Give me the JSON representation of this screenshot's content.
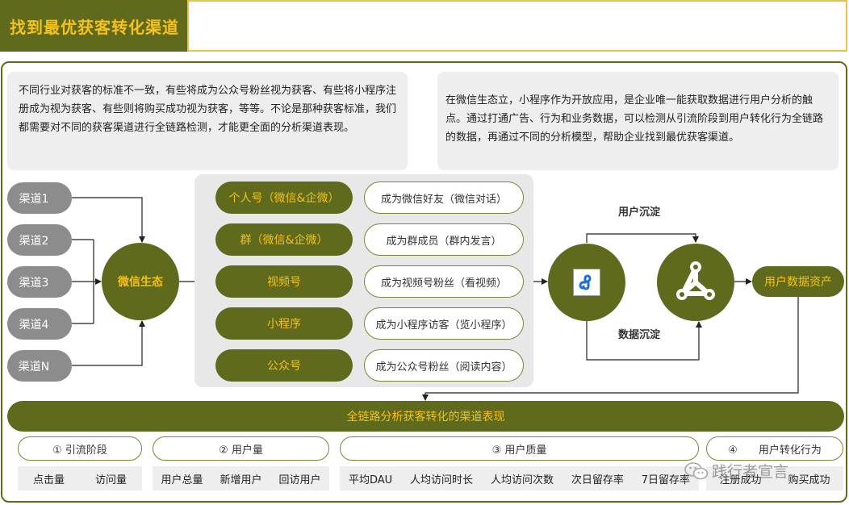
{
  "title": "找到最优获客转化渠道",
  "intro_left": "不同行业对获客的标准不一致，有些将成为公众号粉丝视为获客、有些将小程序注册成为视为获客、有些则将购买成功视为获客，等等。不论是那种获客标准，我们都需要对不同的获客渠道进行全链路检测，才能更全面的分析渠道表现。",
  "intro_right": "在微信生态立，小程序作为开放应用，是企业唯一能获取数据进行用户分析的触点。通过打通广告、行为和业务数据，可以检测从引流阶段到用户转化行为全链路的数据，再通过不同的分析模型，帮助企业找到最优获客渠道。",
  "channels": [
    "渠道1",
    "渠道2",
    "渠道3",
    "渠道4",
    "渠道N"
  ],
  "wechat_eco": "微信生态",
  "platforms": [
    {
      "name": "个人号（微信&企微）",
      "action": "成为微信好友（微信对话）"
    },
    {
      "name": "群（微信&企微）",
      "action": "成为群成员（群内发言）"
    },
    {
      "name": "视频号",
      "action": "成为视频号粉丝（看视频）"
    },
    {
      "name": "小程序",
      "action": "成为小程序访客（览小程序）"
    },
    {
      "name": "公众号",
      "action": "成为公众号粉丝（阅读内容）"
    }
  ],
  "user_settle": "用户沉淀",
  "data_settle": "数据沉淀",
  "user_assets": "用户数据资产",
  "fullchain": "全链路分析获客转化的渠道表现",
  "stages": [
    {
      "label": "① 引流阶段",
      "metrics": [
        "点击量",
        "访问量"
      ]
    },
    {
      "label": "② 用户量",
      "metrics": [
        "用户总量",
        "新增用户",
        "回访用户"
      ]
    },
    {
      "label": "③ 用户质量",
      "metrics": [
        "平均DAU",
        "人均访问时长",
        "人均访问次数",
        "次日留存率",
        "7日留存率"
      ]
    },
    {
      "label": "④　　用户转化行为",
      "metrics": [
        "注册成功",
        "购买成功"
      ]
    }
  ],
  "watermark": "践行者宣言",
  "colors": {
    "olive": "#606a1c",
    "gold": "#f4c21a",
    "gray_channel": "#8c8c8c",
    "panel_gray": "#e8e8e8"
  },
  "icons": {
    "mini_program": "mini-program-icon",
    "graph": "graph-network-icon",
    "watermark": "wechat-icon"
  }
}
